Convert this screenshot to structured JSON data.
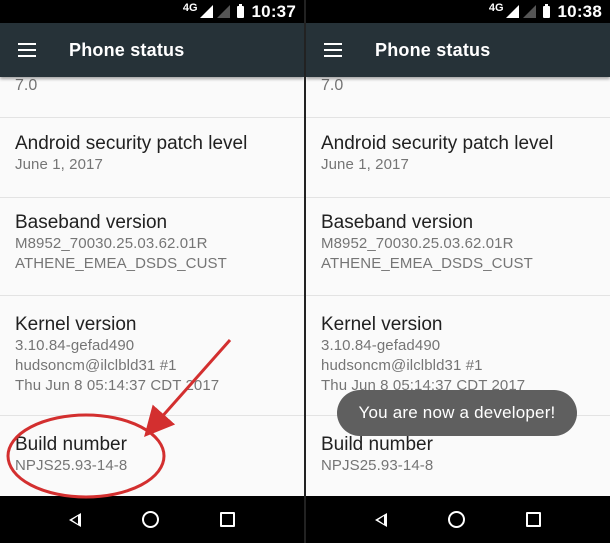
{
  "screens": [
    {
      "status_bar": {
        "network": "4G",
        "time": "10:37"
      },
      "app_bar": {
        "title": "Phone status",
        "menu_icon": "hamburger-menu-icon"
      },
      "partial_row": {
        "value": "7.0"
      },
      "items": [
        {
          "title": "Android security patch level",
          "lines": [
            "June 1, 2017"
          ]
        },
        {
          "title": "Baseband version",
          "lines": [
            "M8952_70030.25.03.62.01R",
            "ATHENE_EMEA_DSDS_CUST"
          ]
        },
        {
          "title": "Kernel version",
          "lines": [
            "3.10.84-gefad490",
            "hudsoncm@ilclbld31 #1",
            "Thu Jun 8 05:14:37 CDT 2017"
          ]
        },
        {
          "title": "Build number",
          "lines": [
            "NPJS25.93-14-8"
          ]
        }
      ],
      "nav_icons": [
        "back-icon",
        "home-icon",
        "recents-icon"
      ]
    },
    {
      "status_bar": {
        "network": "4G",
        "time": "10:38"
      },
      "app_bar": {
        "title": "Phone status",
        "menu_icon": "hamburger-menu-icon"
      },
      "partial_row": {
        "value": "7.0"
      },
      "items": [
        {
          "title": "Android security patch level",
          "lines": [
            "June 1, 2017"
          ]
        },
        {
          "title": "Baseband version",
          "lines": [
            "M8952_70030.25.03.62.01R",
            "ATHENE_EMEA_DSDS_CUST"
          ]
        },
        {
          "title": "Kernel version",
          "lines": [
            "3.10.84-gefad490",
            "hudsoncm@ilclbld31 #1",
            "Thu Jun 8 05:14:37 CDT 2017"
          ]
        },
        {
          "title": "Build number",
          "lines": [
            "NPJS25.93-14-8"
          ]
        }
      ],
      "toast": "You are now a developer!",
      "nav_icons": [
        "back-icon",
        "home-icon",
        "recents-icon"
      ]
    }
  ],
  "colors": {
    "app_bar": "#263238",
    "annotation": "#d32f2f",
    "toast": "#5f5f5f"
  }
}
